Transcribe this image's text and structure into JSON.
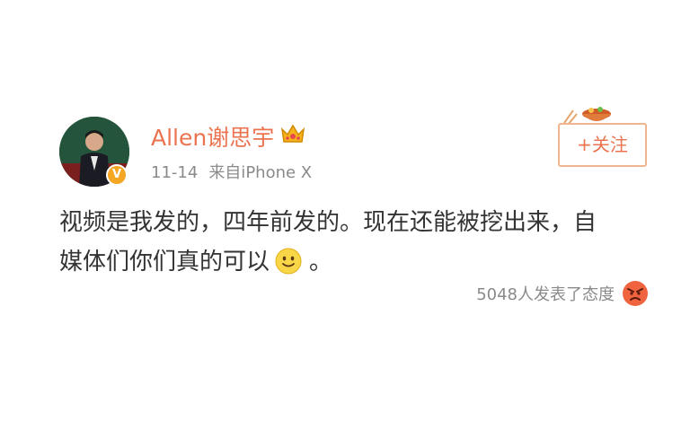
{
  "post": {
    "author": {
      "name": "Allen谢思宇",
      "verified_mark": "V"
    },
    "meta": {
      "date": "11-14",
      "source": "来自iPhone X"
    },
    "follow_button": "+关注",
    "content": {
      "line1": "视频是我发的，四年前发的。现在还能被挖出来，自",
      "line2_before": "媒体们你们真的可以",
      "line2_after": "。"
    },
    "reactions": {
      "label": "5048人发表了态度"
    }
  },
  "icons": {
    "avatar": "avatar-photo",
    "crown": "crown-icon",
    "verified": "verified-badge-icon",
    "smiley": "smiley-emoji-icon",
    "angry": "angry-face-icon",
    "follow_decor": "bowl-decoration-icon"
  },
  "colors": {
    "username": "#eb7350",
    "follow_border": "#f0b48f",
    "meta_text": "#8a8a8a",
    "body_text": "#333333",
    "verified": "#f5a623"
  }
}
